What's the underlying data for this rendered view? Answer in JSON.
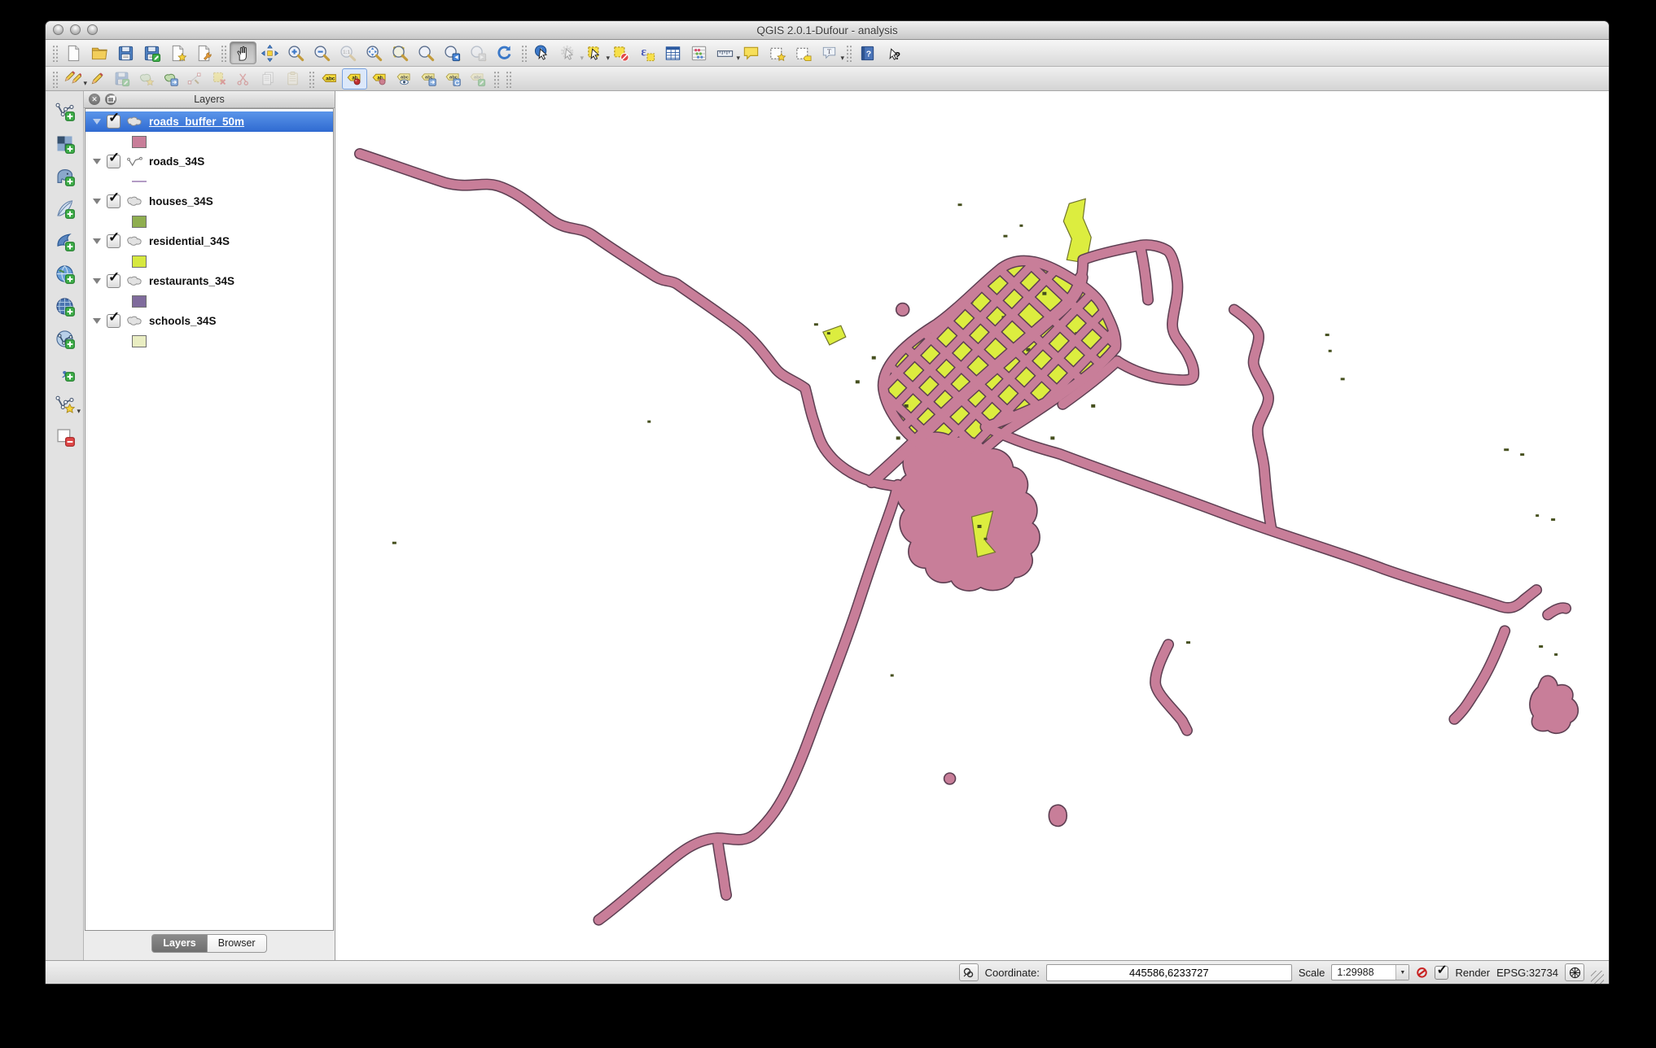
{
  "window": {
    "title": "QGIS 2.0.1-Dufour - analysis"
  },
  "toolbar_main": {
    "items": [
      {
        "sep": true
      },
      {
        "name": "new-project"
      },
      {
        "name": "open-project"
      },
      {
        "name": "save-project"
      },
      {
        "name": "save-project-as"
      },
      {
        "name": "new-composer"
      },
      {
        "name": "composer-manager"
      },
      {
        "sep": true
      },
      {
        "name": "pan",
        "active": true
      },
      {
        "name": "pan-to-selection"
      },
      {
        "name": "zoom-in"
      },
      {
        "name": "zoom-out"
      },
      {
        "name": "zoom-native",
        "disabled": true
      },
      {
        "name": "zoom-full"
      },
      {
        "name": "zoom-selection"
      },
      {
        "name": "zoom-layer"
      },
      {
        "name": "zoom-last"
      },
      {
        "name": "zoom-next",
        "disabled": true
      },
      {
        "name": "refresh"
      },
      {
        "sep": true
      },
      {
        "name": "identify"
      },
      {
        "name": "run-action",
        "disabled": true,
        "dropdown": true
      },
      {
        "name": "select-features",
        "dropdown": true
      },
      {
        "name": "deselect-features"
      },
      {
        "name": "select-expression"
      },
      {
        "name": "attribute-table"
      },
      {
        "name": "field-calculator"
      },
      {
        "name": "measure",
        "dropdown": true
      },
      {
        "name": "map-tips"
      },
      {
        "name": "new-bookmark"
      },
      {
        "name": "show-bookmarks"
      },
      {
        "name": "annotation",
        "dropdown": true
      },
      {
        "sep": true
      },
      {
        "name": "help"
      },
      {
        "name": "whats-this"
      }
    ]
  },
  "toolbar_edit": {
    "items": [
      {
        "sep": true
      },
      {
        "name": "current-edits",
        "dropdown": true
      },
      {
        "name": "toggle-editing"
      },
      {
        "name": "save-edits",
        "disabled": true
      },
      {
        "name": "add-feature",
        "disabled": true
      },
      {
        "name": "move-feature"
      },
      {
        "name": "node-tool",
        "disabled": true
      },
      {
        "name": "delete-selected",
        "disabled": true
      },
      {
        "name": "cut-features",
        "disabled": true
      },
      {
        "name": "copy-features",
        "disabled": true
      },
      {
        "name": "paste-features",
        "disabled": true
      },
      {
        "sep": true
      },
      {
        "name": "labeling"
      },
      {
        "name": "label-move",
        "active": true
      },
      {
        "name": "label-pin"
      },
      {
        "name": "label-showhide"
      },
      {
        "name": "label-arrow"
      },
      {
        "name": "label-rotate"
      },
      {
        "name": "label-properties",
        "disabled": true
      },
      {
        "sep": true
      },
      {
        "sep": true
      }
    ]
  },
  "layer_toolbar": {
    "items": [
      {
        "name": "add-vector-layer"
      },
      {
        "name": "add-raster-layer"
      },
      {
        "name": "add-postgis-layer"
      },
      {
        "name": "add-spatialite-layer"
      },
      {
        "name": "add-mssql-layer"
      },
      {
        "name": "add-wms-layer"
      },
      {
        "name": "add-wcs-layer"
      },
      {
        "name": "add-wfs-layer"
      },
      {
        "name": "add-delimited-text-layer"
      },
      {
        "name": "new-shapefile-layer",
        "dropdown": true
      },
      {
        "name": "remove-layer"
      }
    ]
  },
  "layers_panel": {
    "title": "Layers",
    "layers": [
      {
        "name": "roads_buffer_50m",
        "geometry": "polygon",
        "swatch": "#c87e99",
        "checked": true,
        "selected": true
      },
      {
        "name": "roads_34S",
        "geometry": "line",
        "swatch": "#b39bc5",
        "checked": true,
        "selected": false
      },
      {
        "name": "houses_34S",
        "geometry": "polygon",
        "swatch": "#8fae4f",
        "checked": true,
        "selected": false
      },
      {
        "name": "residential_34S",
        "geometry": "polygon",
        "swatch": "#d6e83f",
        "checked": true,
        "selected": false
      },
      {
        "name": "restaurants_34S",
        "geometry": "polygon",
        "swatch": "#7f6b9c",
        "checked": true,
        "selected": false
      },
      {
        "name": "schools_34S",
        "geometry": "polygon",
        "swatch": "#e9edc2",
        "checked": true,
        "selected": false
      }
    ],
    "tabs": [
      {
        "label": "Layers",
        "selected": true
      },
      {
        "label": "Browser",
        "selected": false
      }
    ]
  },
  "statusbar": {
    "coordinate_label": "Coordinate:",
    "coordinate_value": "445586,6233727",
    "scale_label": "Scale",
    "scale_value": "1:29988",
    "render_label": "Render",
    "render_checked": true,
    "crs_text": "EPSG:32734"
  },
  "map": {
    "background": "#ffffff",
    "road_buffer_fill": "#c87e99",
    "road_buffer_outline": "#5d3f52",
    "residential_fill": "#dced3f",
    "residential_outline": "#70742c",
    "houses_color": "#46501f"
  }
}
